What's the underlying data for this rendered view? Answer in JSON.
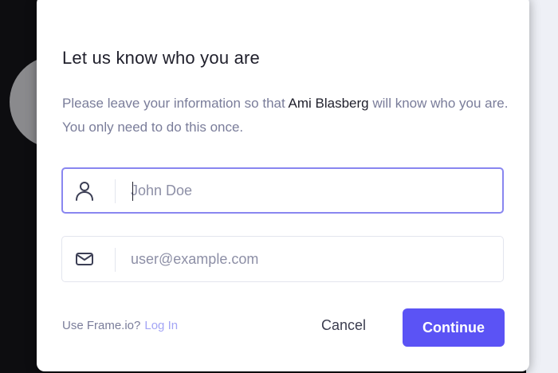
{
  "modal": {
    "title": "Let us know who you are",
    "description_prefix": "Please leave your information so that",
    "owner_name": "Ami Blasberg",
    "description_suffix": "will know who you are. You only need to do this once.",
    "name_field": {
      "placeholder": "John Doe",
      "value": "",
      "icon": "user-icon"
    },
    "email_field": {
      "placeholder": "user@example.com",
      "value": "",
      "icon": "mail-icon"
    },
    "footer": {
      "prompt": "Use Frame.io?",
      "login_label": "Log In",
      "cancel_label": "Cancel",
      "continue_label": "Continue"
    },
    "colors": {
      "accent": "#5b53f5",
      "focus_border": "#8986f0",
      "muted_text": "#7a7d9a"
    }
  }
}
